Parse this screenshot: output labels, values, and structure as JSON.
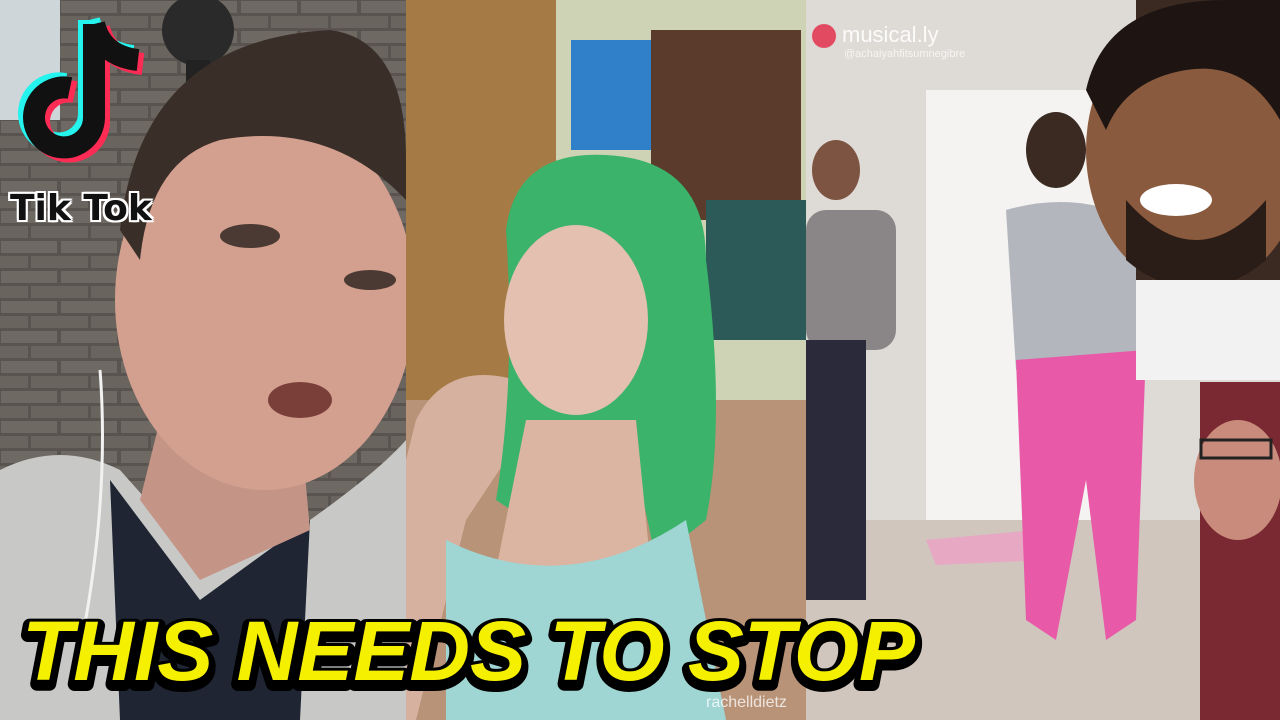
{
  "branding": {
    "app_name": "Tik Tok",
    "musically_name": "musical.ly",
    "musically_user": "@achaiyahfitsumnegibre",
    "watermark_center": "rachelldietz",
    "watermark_left": "rachelldietz"
  },
  "headline": {
    "text": "THIS NEEDS TO STOP",
    "fill_color": "#f5f000",
    "outline_color": "#000000"
  },
  "colors": {
    "tiktok_cyan": "#25f4ee",
    "tiktok_pink": "#fe2c55",
    "green_hair": "#3bb36a",
    "pink_leggings": "#e85aa8"
  }
}
